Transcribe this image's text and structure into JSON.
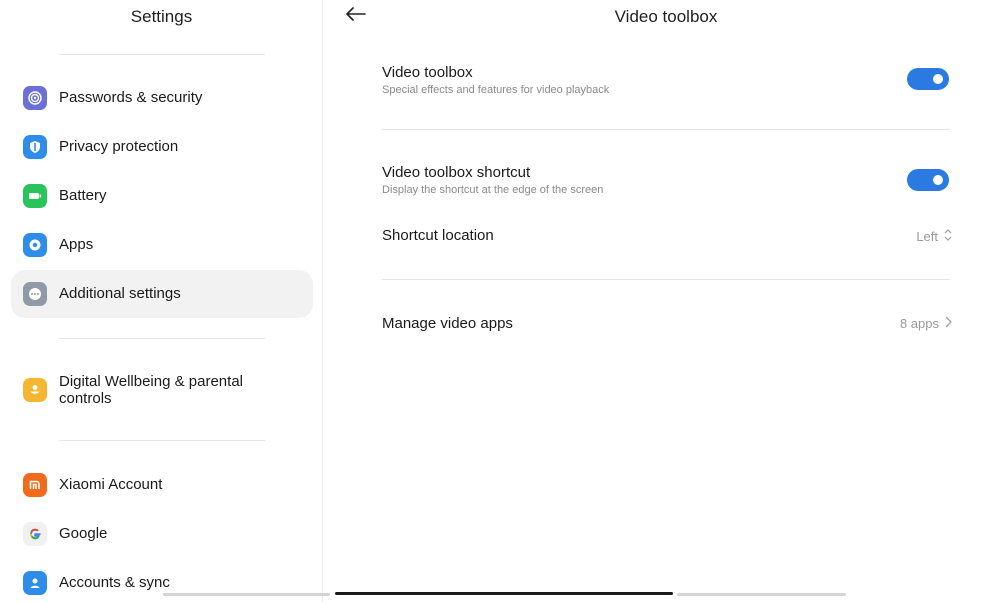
{
  "left": {
    "title": "Settings",
    "items": [
      {
        "label": "Passwords & security",
        "icon": "fingerprint-icon",
        "color": "#6b6fd8"
      },
      {
        "label": "Privacy protection",
        "icon": "privacy-shield-icon",
        "color": "#2d8de8"
      },
      {
        "label": "Battery",
        "icon": "battery-icon",
        "color": "#28c45a"
      },
      {
        "label": "Apps",
        "icon": "gear-icon",
        "color": "#2d8de8"
      },
      {
        "label": "Additional settings",
        "icon": "more-dots-icon",
        "color": "#8f9aa6"
      },
      {
        "label": "Digital Wellbeing & parental controls",
        "icon": "wellbeing-icon",
        "color": "#f5b731"
      },
      {
        "label": "Xiaomi Account",
        "icon": "xiaomi-logo-icon",
        "color": "#f26a1b"
      },
      {
        "label": "Google",
        "icon": "google-logo-icon",
        "color": "#f1f1f1"
      },
      {
        "label": "Accounts & sync",
        "icon": "account-icon",
        "color": "#2d8de8"
      }
    ]
  },
  "right": {
    "title": "Video toolbox",
    "toolbox": {
      "title": "Video toolbox",
      "subtitle": "Special effects and features for video playback",
      "enabled": true
    },
    "shortcut": {
      "title": "Video toolbox shortcut",
      "subtitle": "Display the shortcut at the edge of the screen",
      "enabled": true
    },
    "location": {
      "title": "Shortcut location",
      "value": "Left"
    },
    "manage": {
      "title": "Manage video apps",
      "value": "8 apps"
    }
  },
  "colors": {
    "accent": "#2a7ae2"
  }
}
